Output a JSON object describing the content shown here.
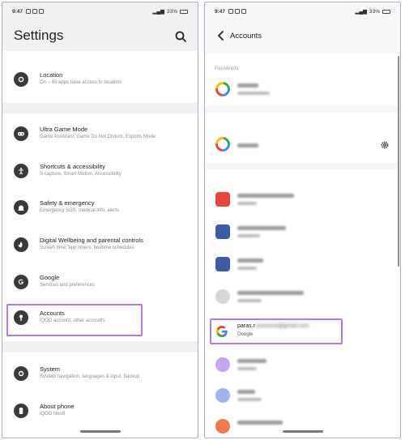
{
  "left": {
    "status": {
      "time": "9:47",
      "battery": "33%"
    },
    "title": "Settings",
    "items": [
      {
        "title": "Location",
        "subtitle": "On – 45 apps have access to location",
        "icon": "location-icon"
      },
      {
        "title": "Ultra Game Mode",
        "subtitle": "Game Assistant, Game Do Not Disturb, Esports Mode",
        "icon": "gamepad-icon"
      },
      {
        "title": "Shortcuts & accessibility",
        "subtitle": "S-capture, Smart Motion, Accessibility",
        "icon": "accessibility-icon"
      },
      {
        "title": "Safety & emergency",
        "subtitle": "Emergency SOS, medical info, alerts",
        "icon": "emergency-icon"
      },
      {
        "title": "Digital Wellbeing and parental controls",
        "subtitle": "Screen time, app timers, bedtime schedules",
        "icon": "wellbeing-icon"
      },
      {
        "title": "Google",
        "subtitle": "Services and preferences",
        "icon": "google-icon"
      },
      {
        "title": "Accounts",
        "subtitle": "iQOO account, other accounts",
        "icon": "key-icon"
      },
      {
        "title": "System",
        "subtitle": "System navigation, languages & input, backup",
        "icon": "system-icon"
      },
      {
        "title": "About phone",
        "subtitle": "iQOO Neo9",
        "icon": "phone-icon"
      }
    ]
  },
  "right": {
    "status": {
      "time": "9:47",
      "battery": "33%"
    },
    "title": "Accounts",
    "section_passwords": "Passwords",
    "account": {
      "email_prefix": "paras.r",
      "email_hidden": "xxxxxxxx@gmail.com",
      "type": "Google"
    }
  },
  "colors": {
    "highlight": "#b87ad9",
    "frame": "#b9a6d6"
  }
}
